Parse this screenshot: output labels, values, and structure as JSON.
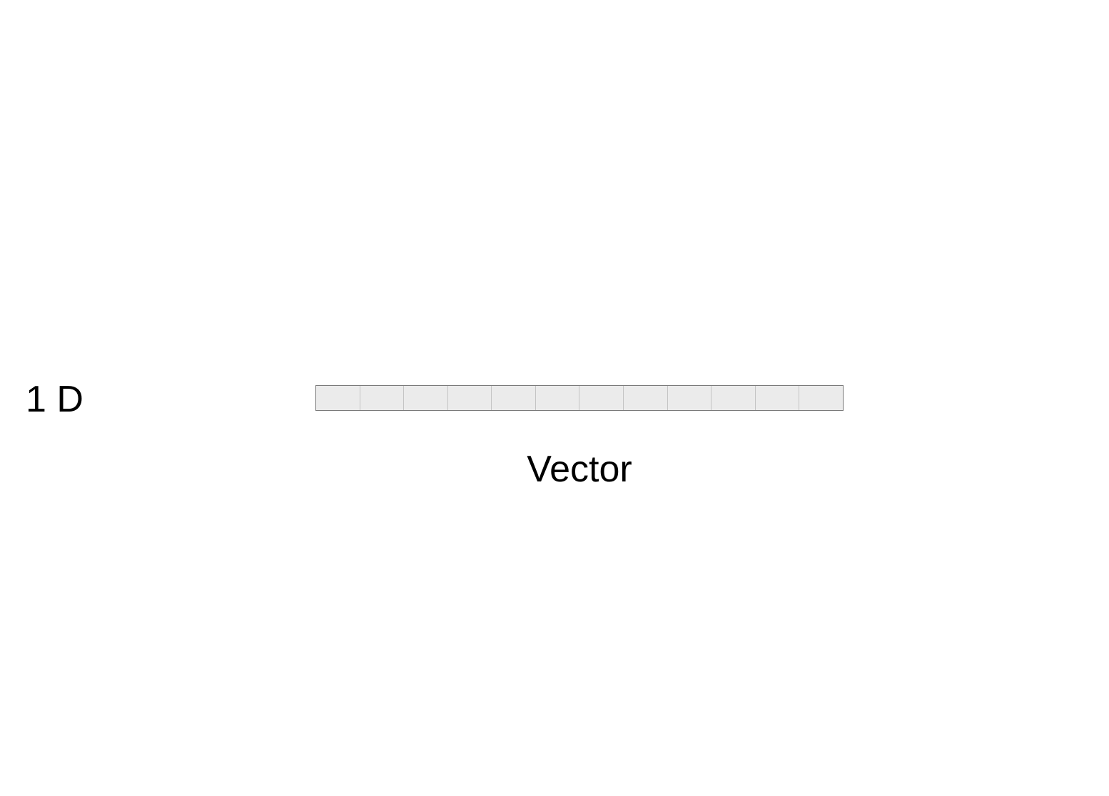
{
  "dimension_label": "1 D",
  "vector": {
    "cell_count": 12,
    "caption": "Vector"
  },
  "colors": {
    "cell_fill": "#ebebeb",
    "cell_border": "#c4c4c4",
    "outer_border": "#7a7a7a",
    "text": "#000000"
  }
}
